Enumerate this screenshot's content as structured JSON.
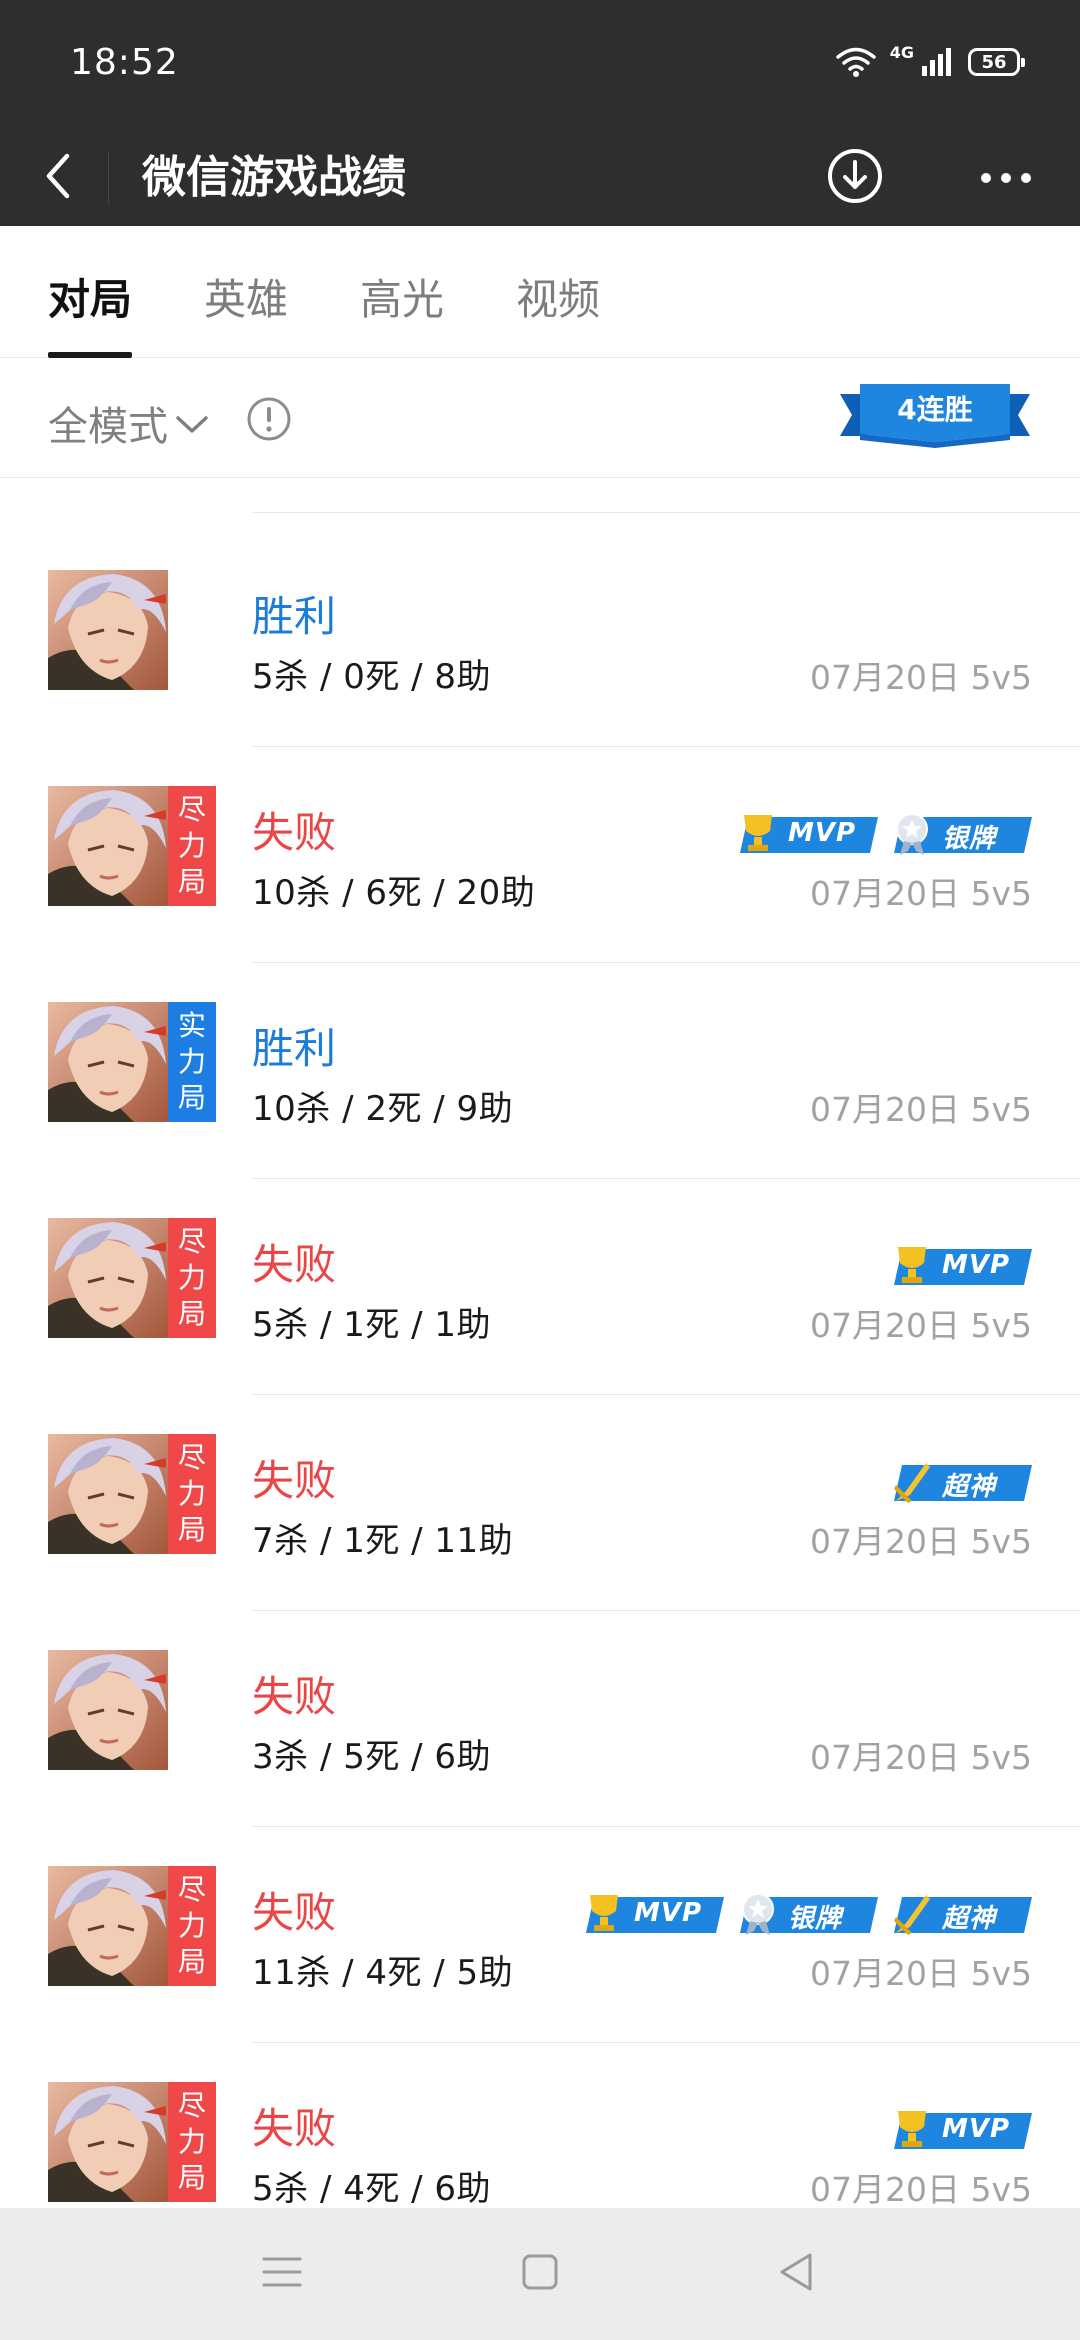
{
  "status_bar": {
    "time": "18:52",
    "network": "4G",
    "battery": "56"
  },
  "header": {
    "title": "微信游戏战绩",
    "icons": [
      "back-arrow-icon",
      "download-icon",
      "more-icon"
    ]
  },
  "tabs": [
    {
      "label": "对局",
      "active": true
    },
    {
      "label": "英雄",
      "active": false
    },
    {
      "label": "高光",
      "active": false
    },
    {
      "label": "视频",
      "active": false
    }
  ],
  "filter": {
    "mode_label": "全模式",
    "streak_label": "4连胜"
  },
  "colors": {
    "win": "#1b7dd9",
    "lose": "#e94747",
    "tag_red": "#f04848",
    "tag_blue": "#1c7ee2",
    "badge_blue": "#1f86e0",
    "header_bg": "#2e2e2e"
  },
  "badge_labels": {
    "mvp": "MVP",
    "silver": "银牌",
    "legendary": "超神"
  },
  "matches": [
    {
      "result": "胜利",
      "outcome": "win",
      "tag": "",
      "kda": "5杀 / 0死 / 8助",
      "meta": "07月20日 5v5",
      "badges": []
    },
    {
      "result": "失败",
      "outcome": "lose",
      "tag": "尽力局",
      "kda": "10杀 / 6死 / 20助",
      "meta": "07月20日 5v5",
      "badges": [
        "mvp",
        "silver"
      ]
    },
    {
      "result": "胜利",
      "outcome": "win",
      "tag": "实力局",
      "kda": "10杀 / 2死 / 9助",
      "meta": "07月20日 5v5",
      "badges": []
    },
    {
      "result": "失败",
      "outcome": "lose",
      "tag": "尽力局",
      "kda": "5杀 / 1死 / 1助",
      "meta": "07月20日 5v5",
      "badges": [
        "mvp"
      ]
    },
    {
      "result": "失败",
      "outcome": "lose",
      "tag": "尽力局",
      "kda": "7杀 / 1死 / 11助",
      "meta": "07月20日 5v5",
      "badges": [
        "legendary"
      ]
    },
    {
      "result": "失败",
      "outcome": "lose",
      "tag": "",
      "kda": "3杀 / 5死 / 6助",
      "meta": "07月20日 5v5",
      "badges": []
    },
    {
      "result": "失败",
      "outcome": "lose",
      "tag": "尽力局",
      "kda": "11杀 / 4死 / 5助",
      "meta": "07月20日 5v5",
      "badges": [
        "mvp",
        "silver",
        "legendary"
      ]
    },
    {
      "result": "失败",
      "outcome": "lose",
      "tag": "尽力局",
      "kda": "5杀 / 4死 / 6助",
      "meta": "07月20日 5v5",
      "badges": [
        "mvp"
      ]
    }
  ],
  "nav_bar": {
    "icons": [
      "menu-icon",
      "home-icon",
      "back-icon"
    ]
  }
}
